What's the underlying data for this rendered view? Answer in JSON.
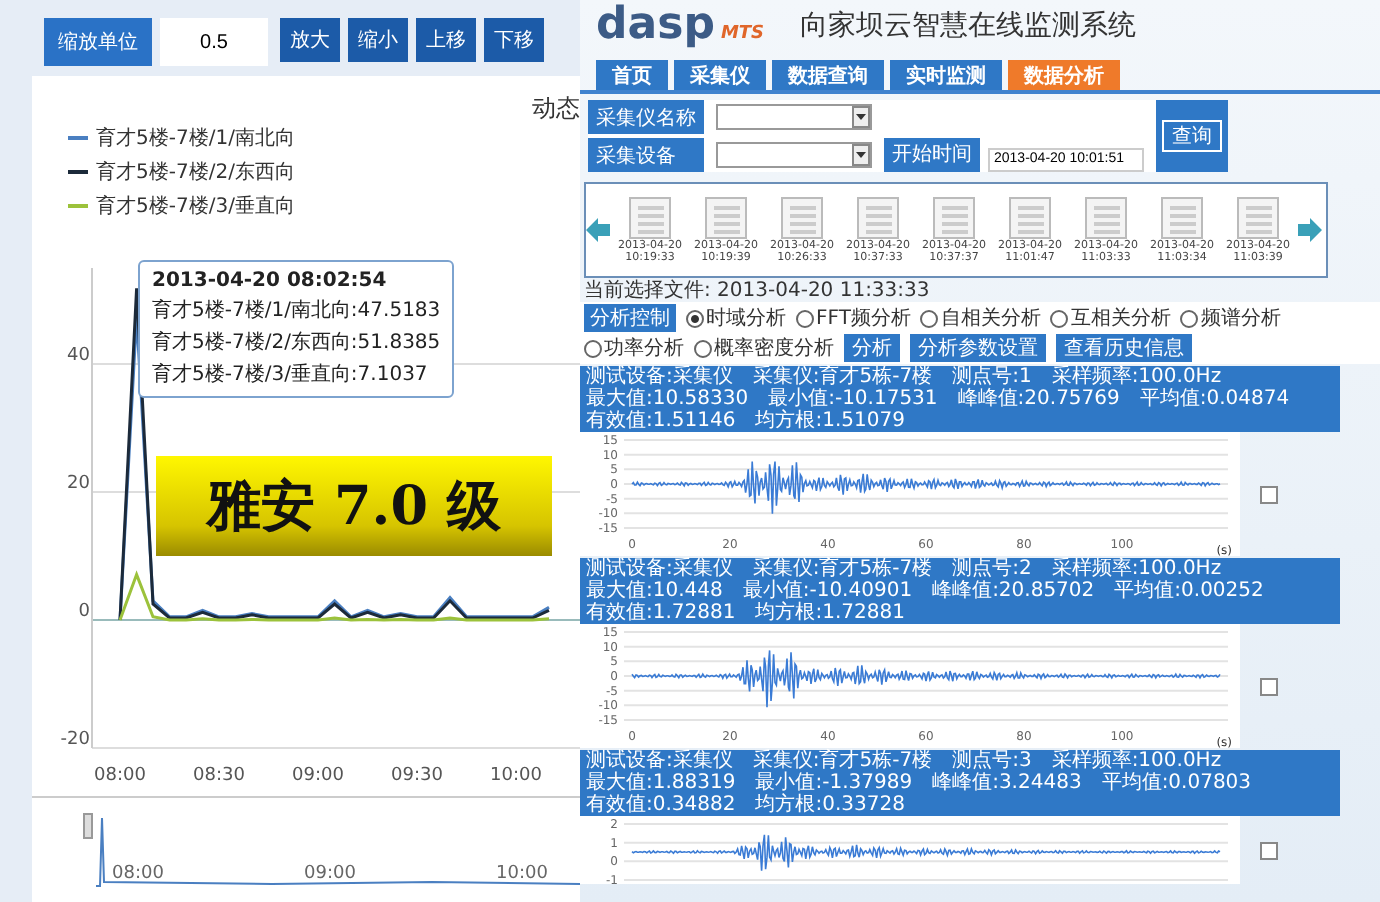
{
  "toolbar": {
    "label": "缩放单位",
    "value": "0.5",
    "buttons": [
      "放大",
      "缩小",
      "上移",
      "下移"
    ]
  },
  "trend_panel": {
    "title_fragment": "动态",
    "tooltip": {
      "time": "2013-04-20 08:02:54",
      "lines": [
        "育才5楼-7楼/1/南北向:47.5183",
        "育才5楼-7楼/2/东西向:51.8385",
        "育才5楼-7楼/3/垂直向:7.1037"
      ]
    },
    "banner": "雅安 7.0 级",
    "chart_data": {
      "type": "line",
      "categories": [
        "08:00",
        null,
        null,
        null,
        null,
        null,
        "08:30",
        null,
        null,
        null,
        null,
        null,
        "09:00",
        null,
        null,
        null,
        null,
        null,
        "09:30",
        null,
        null,
        null,
        null,
        null,
        "10:00",
        null,
        null
      ],
      "series": [
        {
          "name": "育才5楼-7楼/1/南北向",
          "color": "#4a7fc1",
          "values": [
            0,
            47.5,
            3,
            0.5,
            0.5,
            1.5,
            0.5,
            0.5,
            1,
            0.5,
            0.5,
            0.5,
            0.5,
            3,
            0.5,
            1.5,
            0.5,
            1,
            0.5,
            0.5,
            3.5,
            0.5,
            0.5,
            0.5,
            0.5,
            0.5,
            2
          ]
        },
        {
          "name": "育才5楼-7楼/2/东西向",
          "color": "#1c2a3a",
          "values": [
            0,
            51.8,
            2.5,
            0.3,
            0.3,
            1.2,
            0.3,
            0.3,
            0.8,
            0.3,
            0.3,
            0.3,
            0.3,
            2.5,
            0.3,
            1.2,
            0.3,
            0.8,
            0.3,
            0.3,
            3,
            0.3,
            0.3,
            0.3,
            0.3,
            0.3,
            1.5
          ]
        },
        {
          "name": "育才5楼-7楼/3/垂直向",
          "color": "#9cc23b",
          "values": [
            0,
            7.1,
            0.5,
            0,
            0,
            0.2,
            0,
            0,
            0.1,
            0,
            0,
            0,
            0,
            0.3,
            0,
            0.1,
            0,
            0.1,
            0,
            0,
            0.3,
            0,
            0,
            0,
            0,
            0,
            0.2
          ]
        }
      ],
      "ylim": [
        -20,
        55
      ],
      "yticks": [
        -20,
        0,
        20,
        40
      ]
    },
    "navigator": {
      "x_labels": [
        "08:00",
        "09:00",
        "10:00"
      ]
    }
  },
  "monitor": {
    "logo": "dasp",
    "logo_sub": "MTS",
    "title": "向家坝云智慧在线监测系统",
    "tabs": [
      {
        "label": "首页",
        "selected": false
      },
      {
        "label": "采集仪",
        "selected": false
      },
      {
        "label": "数据查询",
        "selected": false
      },
      {
        "label": "实时监测",
        "selected": false
      },
      {
        "label": "数据分析",
        "selected": true
      }
    ],
    "form": {
      "fields": [
        {
          "label": "采集仪名称"
        },
        {
          "label": "采集设备"
        }
      ],
      "start_label": "开始时间",
      "start_value": "2013-04-20 10:01:51",
      "query_button": "查询"
    },
    "thumbnails": [
      "2013-04-20 10:19:33",
      "2013-04-20 10:19:39",
      "2013-04-20 10:26:33",
      "2013-04-20 10:37:33",
      "2013-04-20 10:37:37",
      "2013-04-20 11:01:47",
      "2013-04-20 11:03:33",
      "2013-04-20 11:03:34",
      "2013-04-20 11:03:39"
    ],
    "current_file": "当前选择文件: 2013-04-20 11:33:33",
    "analysis": {
      "label": "分析控制",
      "options": [
        {
          "label": "时域分析",
          "selected": true
        },
        {
          "label": "FFT频分析",
          "selected": false
        },
        {
          "label": "自相关分析",
          "selected": false
        },
        {
          "label": "互相关分析",
          "selected": false
        },
        {
          "label": "频谱分析",
          "selected": false
        },
        {
          "label": "功率分析",
          "selected": false
        },
        {
          "label": "概率密度分析",
          "selected": false
        }
      ],
      "buttons": [
        "分析",
        "分析参数设置",
        "查看历史信息"
      ]
    },
    "channels": [
      {
        "info": [
          "测试设备:采集仪",
          "采集仪:育才5栋-7楼",
          "测点号:1",
          "采样频率:100.0Hz"
        ],
        "stats": [
          "最大值:10.58330",
          "最小值:-10.17531",
          "峰峰值:20.75769",
          "平均值:0.04874",
          "有效值:1.51146",
          "均方根:1.51079"
        ],
        "y_ticks": [
          "15",
          "10",
          "5",
          "0",
          "-5",
          "-10",
          "-15"
        ],
        "x_ticks": [
          "0",
          "20",
          "40",
          "60",
          "80",
          "100"
        ],
        "x_unit": "(s)",
        "checked": false
      },
      {
        "info": [
          "测试设备:采集仪",
          "采集仪:育才5栋-7楼",
          "测点号:2",
          "采样频率:100.0Hz"
        ],
        "stats": [
          "最大值:10.448",
          "最小值:-10.40901",
          "峰峰值:20.85702",
          "平均值:0.00252",
          "有效值:1.72881",
          "均方根:1.72881"
        ],
        "y_ticks": [
          "15",
          "10",
          "5",
          "0",
          "-5",
          "-10",
          "-15"
        ],
        "x_ticks": [
          "0",
          "20",
          "40",
          "60",
          "80",
          "100"
        ],
        "x_unit": "(s)",
        "checked": false
      },
      {
        "info": [
          "测试设备:采集仪",
          "采集仪:育才5栋-7楼",
          "测点号:3",
          "采样频率:100.0Hz"
        ],
        "stats": [
          "最大值:1.88319",
          "最小值:-1.37989",
          "峰峰值:3.24483",
          "平均值:0.07803",
          "有效值:0.34882",
          "均方根:0.33728"
        ],
        "y_ticks": [
          "2",
          "1",
          "0",
          "-1"
        ],
        "checked": false
      }
    ]
  }
}
